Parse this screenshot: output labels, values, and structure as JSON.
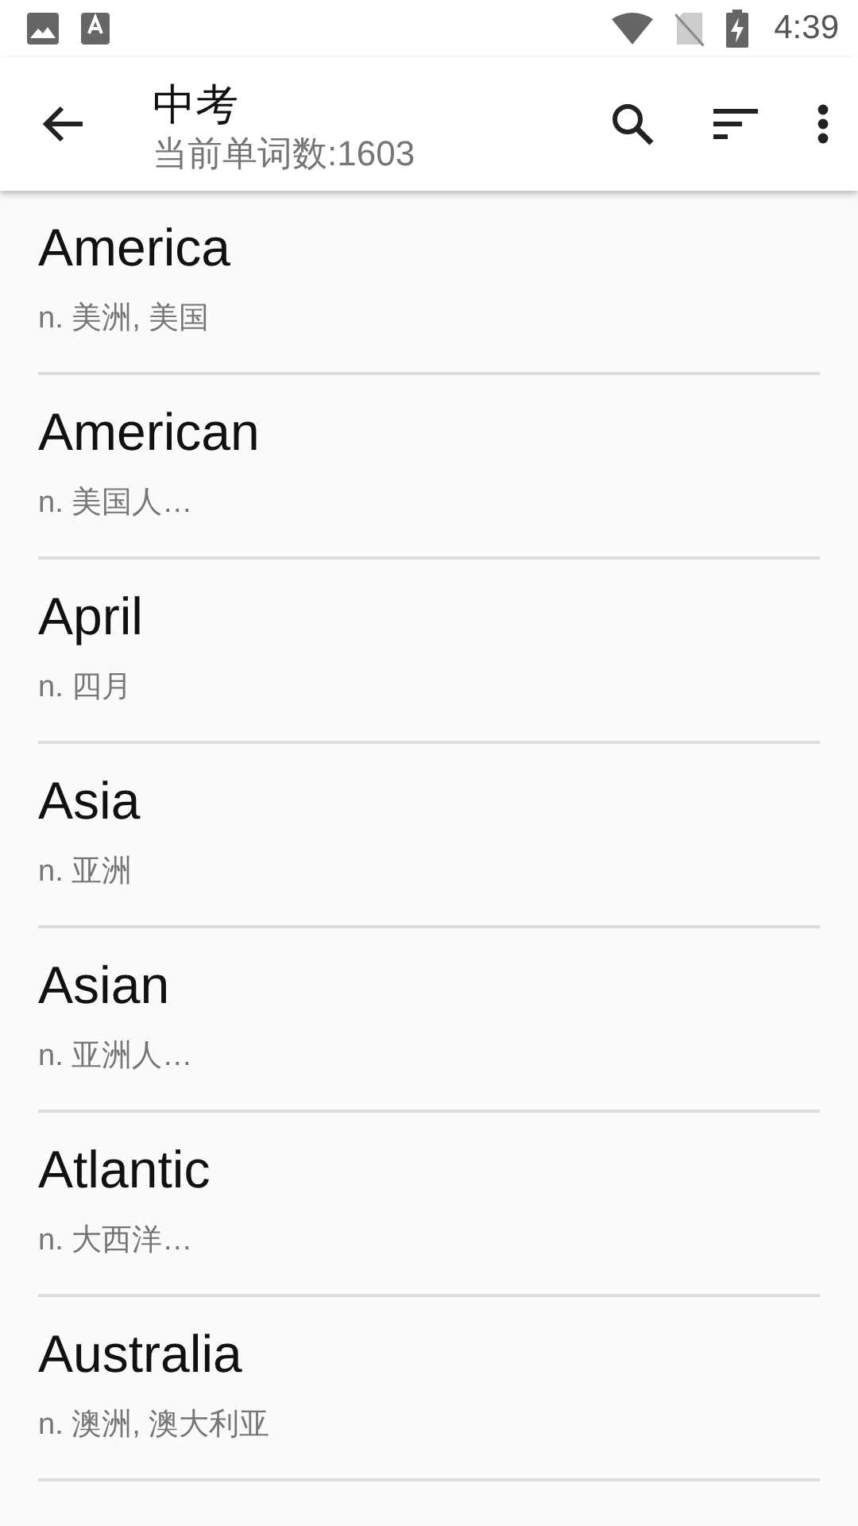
{
  "status_bar": {
    "time": "4:39"
  },
  "app_bar": {
    "title": "中考",
    "subtitle": "当前单词数:1603"
  },
  "words": [
    {
      "word": "America",
      "meaning": "n. 美洲, 美国"
    },
    {
      "word": "American",
      "meaning": "n. 美国人…"
    },
    {
      "word": "April",
      "meaning": "n. 四月"
    },
    {
      "word": "Asia",
      "meaning": "n. 亚洲"
    },
    {
      "word": "Asian",
      "meaning": "n. 亚洲人…"
    },
    {
      "word": "Atlantic",
      "meaning": "n. 大西洋…"
    },
    {
      "word": "Australia",
      "meaning": "n. 澳洲, 澳大利亚"
    }
  ]
}
